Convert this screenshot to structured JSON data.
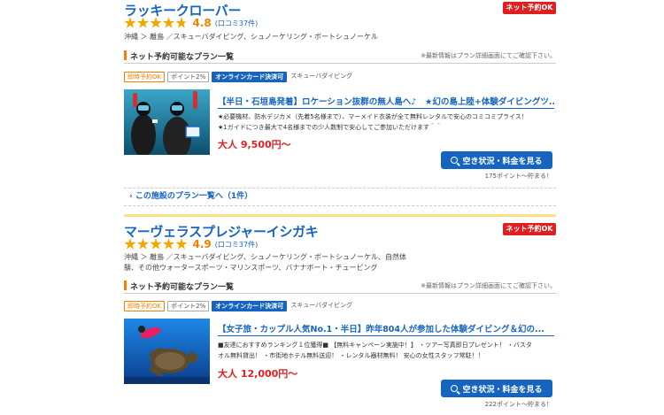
{
  "listings": [
    {
      "name": "ラッキークローバー",
      "badge": "ネット予約OK",
      "rating": "4.8",
      "reviews": "(口コミ37件)",
      "area": "沖縄 ＞ 離島 ／スキューバダイビング、シュノーケリング・ボートシュノーケル",
      "section_title": "ネット予約可能なプラン一覧",
      "section_note": "※最新情報はプラン詳細画面にてご確認下さい。",
      "tags": [
        "即時予約OK",
        "ポイント2%",
        "オンラインカード決済可",
        "スキューバダイビング"
      ],
      "plan_title": "【半日・石垣島発着】ロケーション抜群の無人島へ♪　★幻の島上陸+体験ダイビングツ...",
      "desc_lines": [
        "★必要機材、防水デジカメ（先着5名様まで）、マーメイド衣装が全て無料レンタルで安心のコミコミプライス！",
        "★1ガイドにつき最大で4名様までの少人数制で安心してご参加いただけます＾＾"
      ],
      "price": "大人 9,500円〜",
      "button": "空き状況・料金を見る",
      "points": "175ポイント〜貯まる！",
      "more_link": "この施設のプラン一覧へ（1件）"
    },
    {
      "name": "マーヴェラスプレジャーイシガキ",
      "badge": "ネット予約OK",
      "rating": "4.9",
      "reviews": "(口コミ37件)",
      "area_lines": [
        "沖縄 ＞ 離島 ／スキューバダイビング、シュノーケリング・ボートシュノーケル、自然体",
        "験、その他ウォータースポーツ・マリンスポーツ、バナナボート・チュービング"
      ],
      "section_title": "ネット予約可能なプラン一覧",
      "section_note": "※最新情報はプラン詳細画面にてご確認下さい。",
      "tags": [
        "即時予約OK",
        "ポイント2%",
        "オンラインカード決済可",
        "スキューバダイビング"
      ],
      "plan_title": "【女子旅・カップル人気No.1・半日】昨年804人が参加した体験ダイビング＆幻の...",
      "desc_lines": [
        "■友達におすすめランキング１位獲得■ 【無料キャンペーン実施中！】 ・ツアー写真即日プレゼント！ ・バスタ",
        "オル無料貸出！ ・市街地ホテル無料送迎！ ・レンタル器材無料！ 安心の女性スタッフ常駐！！"
      ],
      "price": "大人 12,000円〜",
      "button": "空き状況・料金を見る",
      "points": "222ポイント〜貯まる！"
    }
  ],
  "colors": {
    "link": "#1565c0",
    "accent": "#f08000",
    "red": "#e02020",
    "divider": "#ffe082"
  },
  "icons": [
    "star-icon",
    "search-icon"
  ]
}
